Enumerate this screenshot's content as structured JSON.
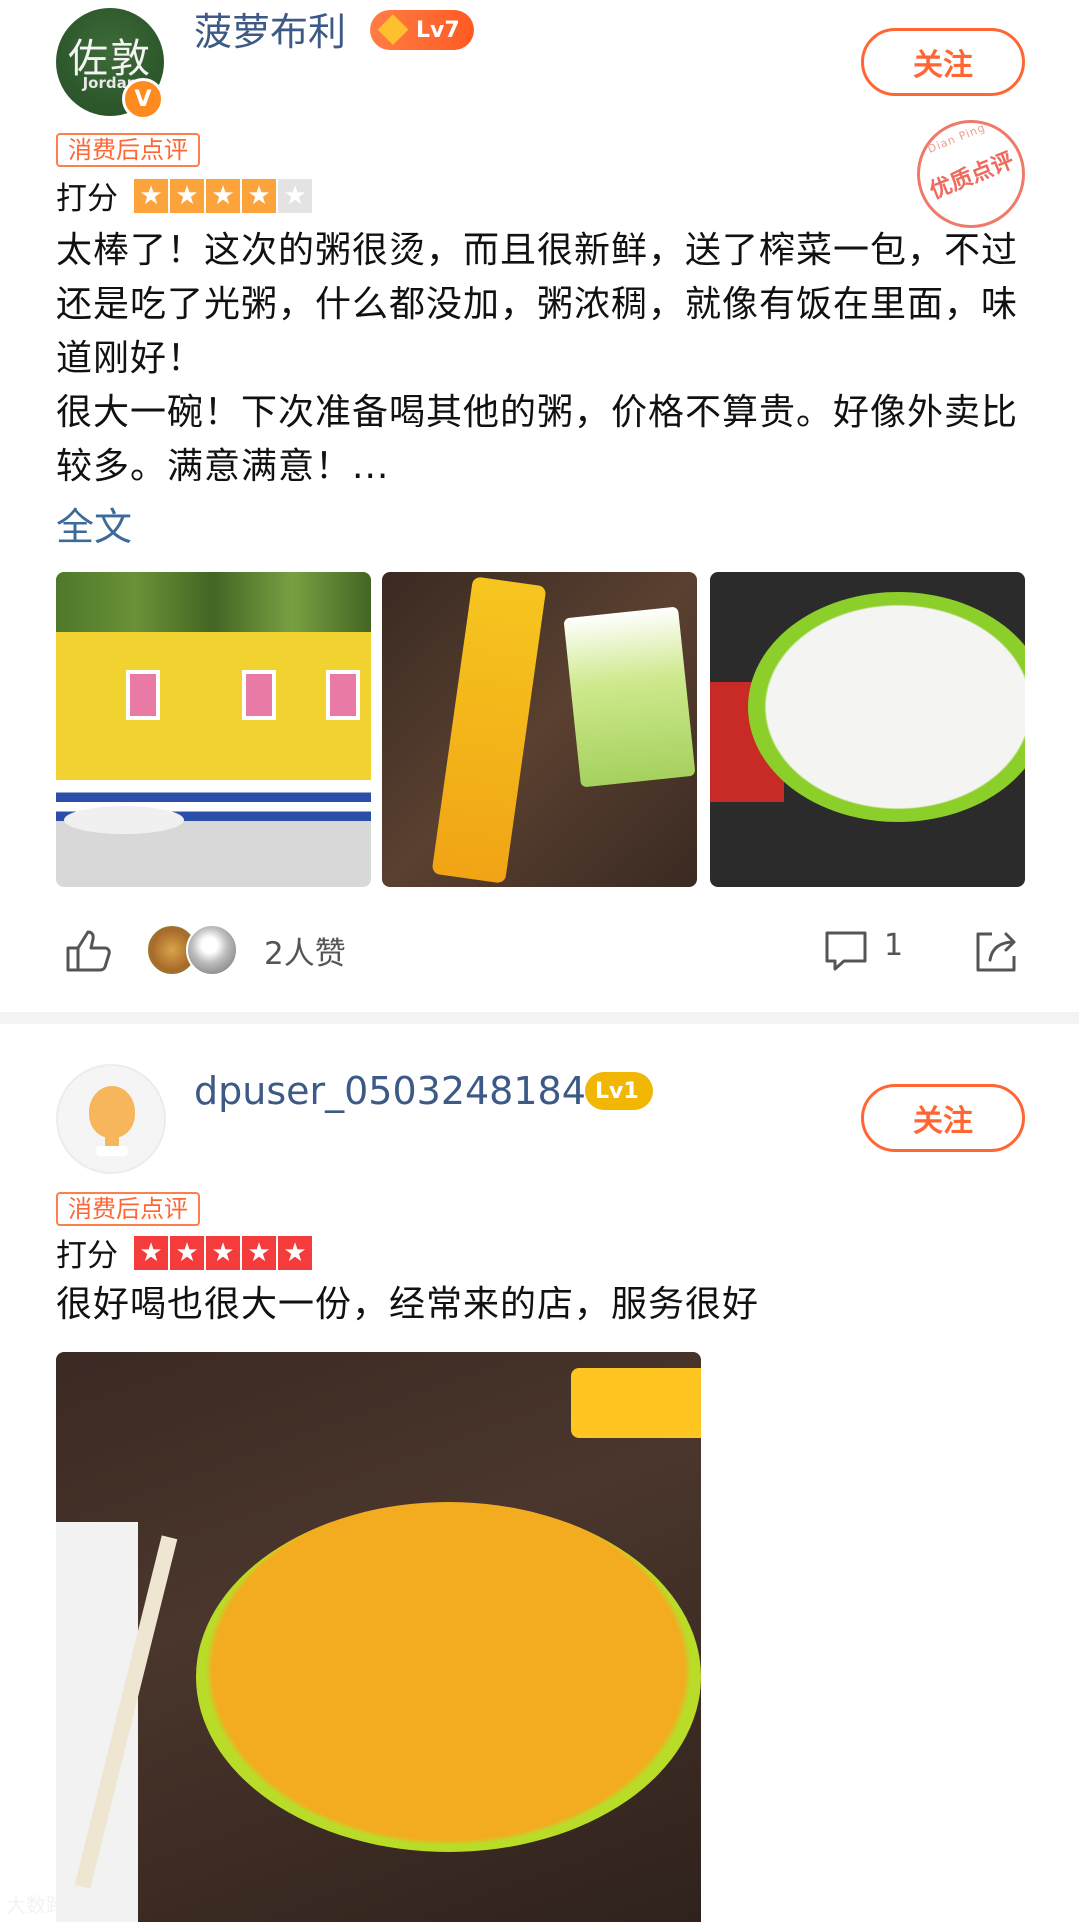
{
  "reviews": [
    {
      "user": {
        "name": "菠萝布利",
        "level": "Lv7",
        "avatar_text": "佐敦",
        "avatar_subtext": "Jordan",
        "verified_mark": "V"
      },
      "follow_label": "关注",
      "quality_stamp": {
        "text": "优质点评",
        "arc_text": "Dian Ping"
      },
      "tag": "消费后点评",
      "score_label": "打分",
      "stars_filled": 4,
      "stars_total": 5,
      "text": "太棒了！这次的粥很烫，而且很新鲜，送了榨菜一包，不过还是吃了光粥，什么都没加，粥浓稠，就像有饭在里面，味道刚好！\n很大一碗！下次准备喝其他的粥，价格不算贵。好像外卖比较多。满意满意！...",
      "full_text_link": "全文",
      "photo_count": 3,
      "likes_text": "2人赞",
      "comment_count": "1"
    },
    {
      "user": {
        "name": "dpuser_0503248184",
        "level": "Lv1"
      },
      "follow_label": "关注",
      "tag": "消费后点评",
      "score_label": "打分",
      "stars_filled": 5,
      "stars_total": 5,
      "text": "很好喝也很大一份，经常来的店，服务很好"
    }
  ],
  "watermark": "大数跨境",
  "colors": {
    "accent": "#ff6633",
    "username": "#3d5a86",
    "link": "#3d6a99",
    "star_orange": "#fda33b",
    "star_red": "#f53c3c"
  },
  "icons": [
    "star-icon",
    "like-icon",
    "comment-icon",
    "share-icon",
    "verified-icon",
    "diamond-icon"
  ]
}
